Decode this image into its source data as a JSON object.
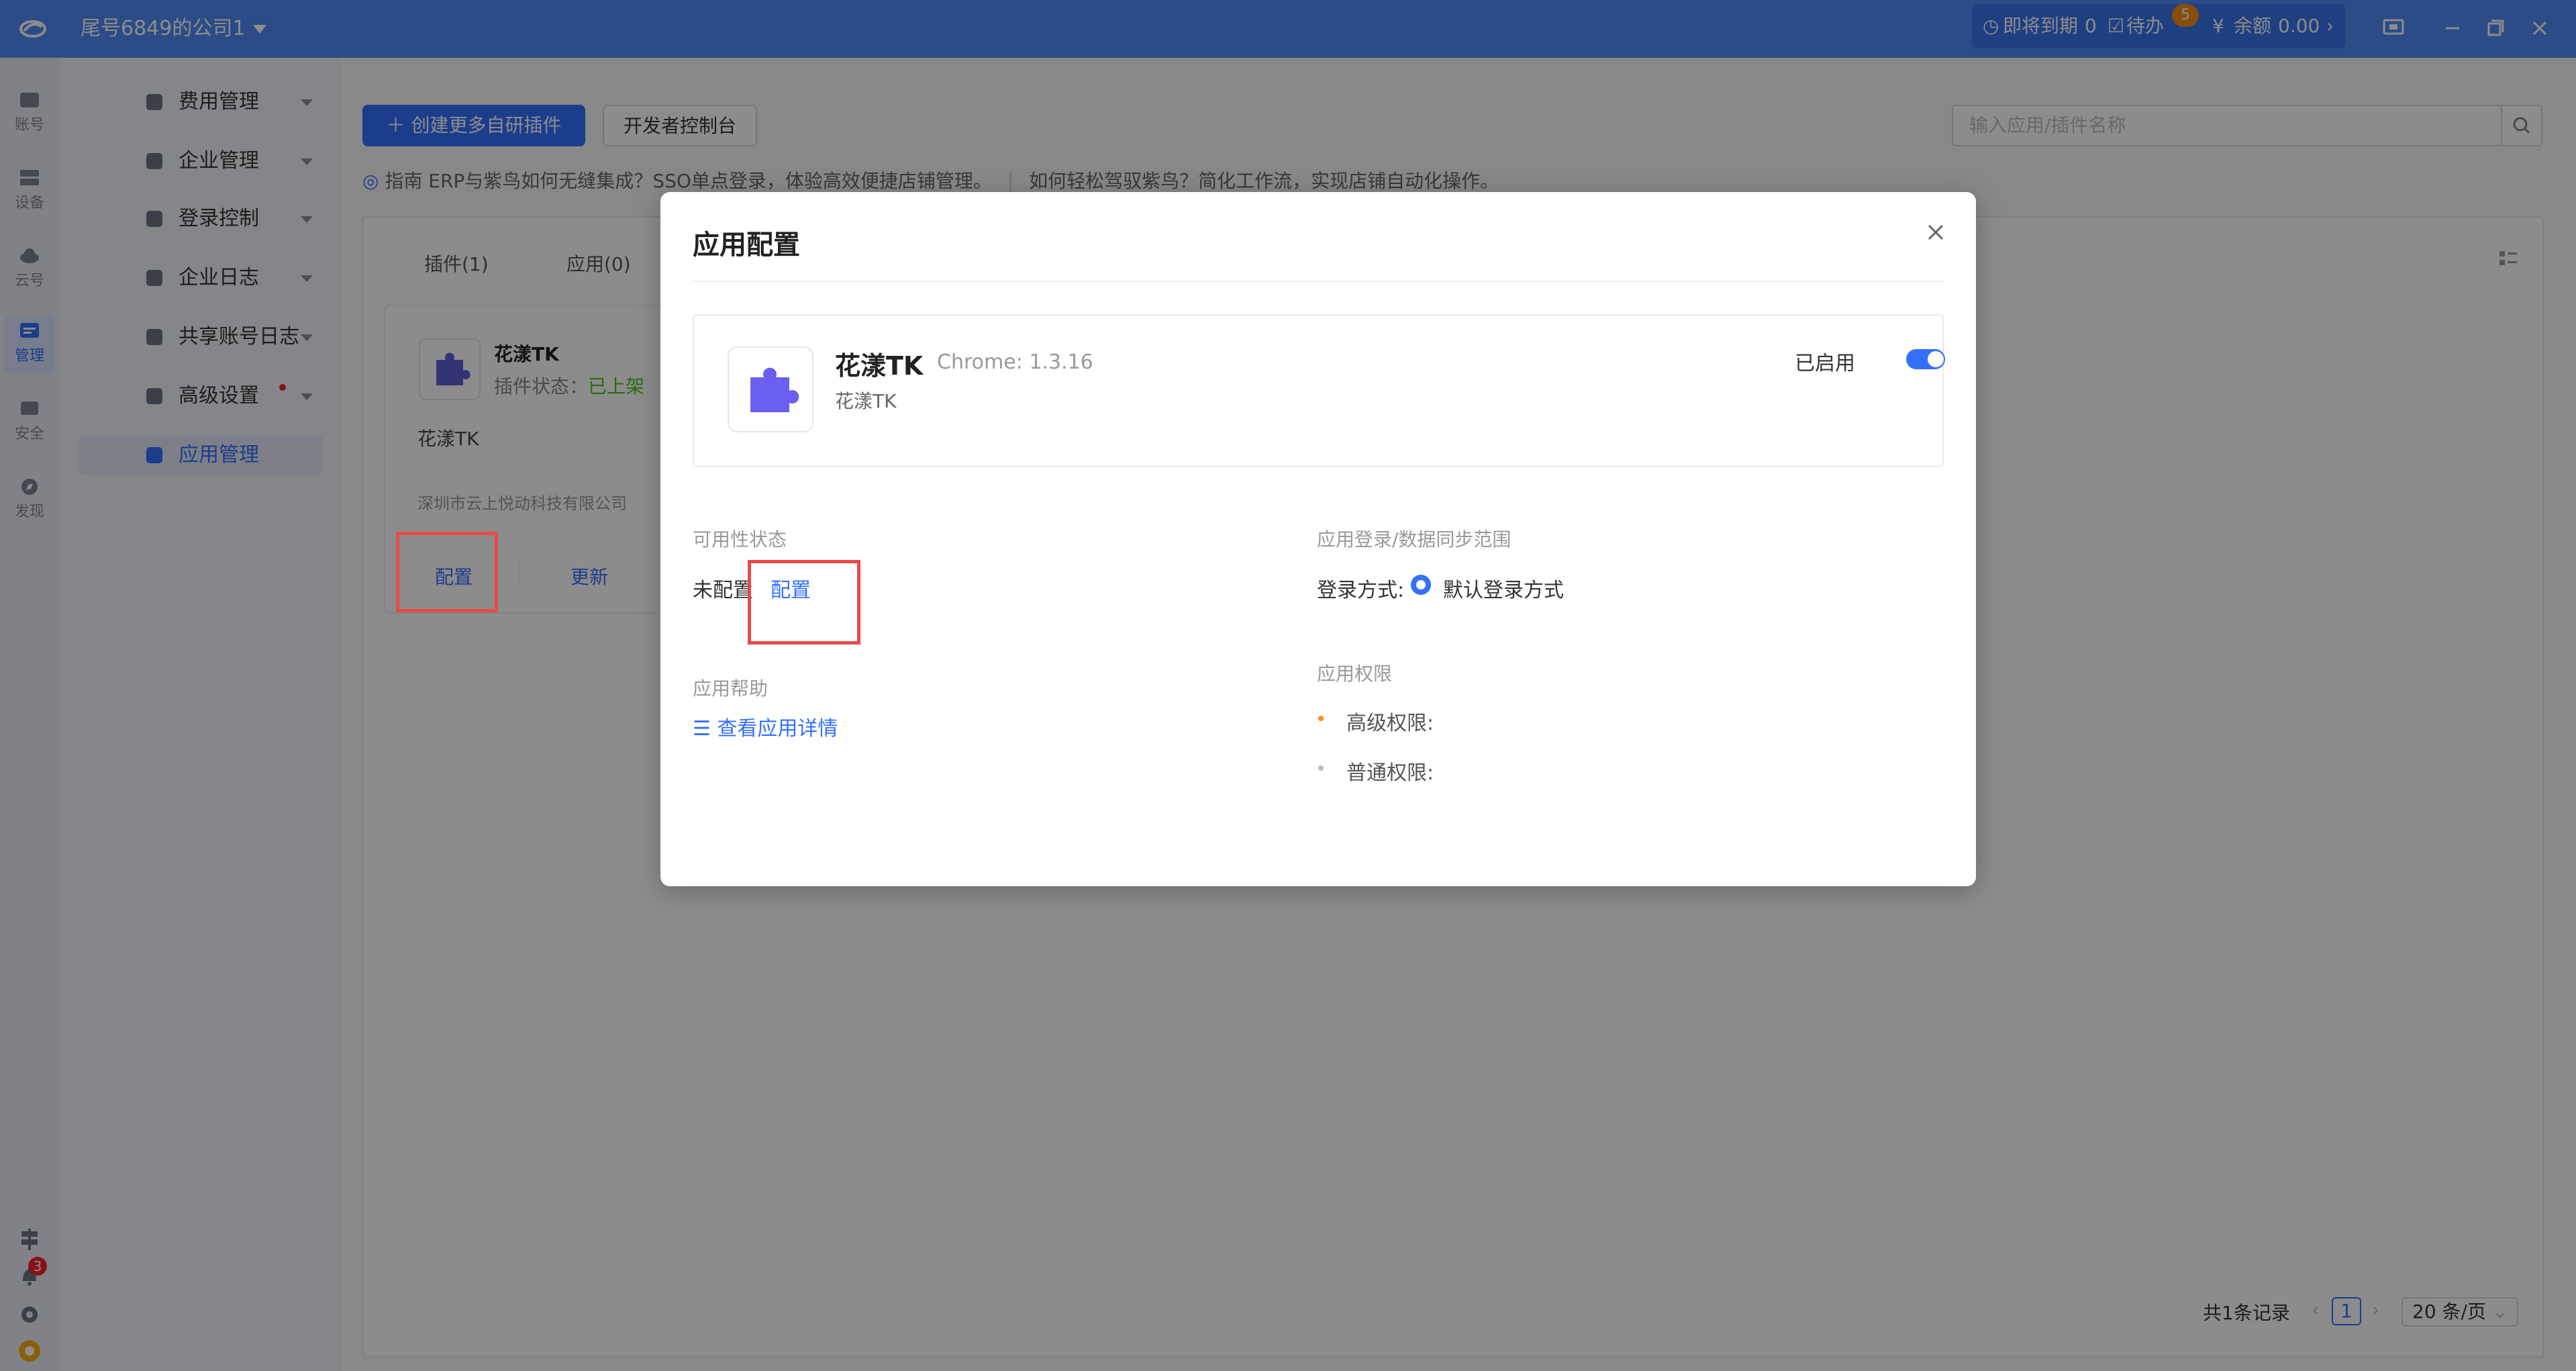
{
  "titlebar": {
    "company": "尾号6849的公司1",
    "expiring_label": "即将到期",
    "expiring_count": "0",
    "todo_label": "待办",
    "todo_count": "5",
    "balance_label": "余额",
    "balance_value": "0.00"
  },
  "rail": [
    {
      "label": "账号",
      "icon": "store-icon"
    },
    {
      "label": "设备",
      "icon": "device-icon"
    },
    {
      "label": "云号",
      "icon": "cloud-icon"
    },
    {
      "label": "管理",
      "icon": "manage-icon",
      "active": true
    },
    {
      "label": "安全",
      "icon": "shield-icon"
    },
    {
      "label": "发现",
      "icon": "compass-icon"
    }
  ],
  "rail_bottom": {
    "notification_count": "3"
  },
  "subnav": [
    {
      "label": "费用管理"
    },
    {
      "label": "企业管理"
    },
    {
      "label": "登录控制"
    },
    {
      "label": "企业日志"
    },
    {
      "label": "共享账号日志"
    },
    {
      "label": "高级设置"
    },
    {
      "label": "应用管理",
      "active": true
    }
  ],
  "toolbar": {
    "create_plugin": "创建更多自研插件",
    "developer_console": "开发者控制台",
    "search_placeholder": "输入应用/插件名称"
  },
  "guide": {
    "prefix": "指南",
    "text1": "ERP与紫鸟如何无缝集成？SSO单点登录，体验高效便捷店铺管理。",
    "text2": "如何轻松驾驭紫鸟？简化工作流，实现店铺自动化操作。"
  },
  "tabs": [
    {
      "label": "插件(1)"
    },
    {
      "label": "应用(0)"
    }
  ],
  "card": {
    "name": "花漾TK",
    "status_label": "插件状态：",
    "status_value": "已上架",
    "desc": "花漾TK",
    "company": "深圳市云上悦动科技有限公司",
    "config": "配置",
    "update": "更新"
  },
  "pagination": {
    "total": "共1条记录",
    "current_page": "1",
    "page_size": "20 条/页"
  },
  "modal": {
    "title": "应用配置",
    "app_name": "花漾TK",
    "app_version": "Chrome: 1.3.16",
    "app_sub": "花漾TK",
    "enabled_label": "已启用",
    "enabled": true,
    "availability_label": "可用性状态",
    "availability_value": "未配置",
    "config_link": "配置",
    "help_label": "应用帮助",
    "help_link": "查看应用详情",
    "login_scope_label": "应用登录/数据同步范围",
    "login_method_label": "登录方式:",
    "login_method_value": "默认登录方式",
    "permissions_label": "应用权限",
    "advanced_perm": "高级权限:",
    "normal_perm": "普通权限:"
  },
  "colors": {
    "accent": "#3370ff",
    "titlebar": "#4f8af5",
    "highlight": "#e84a4a",
    "status_green": "#52c41a"
  }
}
